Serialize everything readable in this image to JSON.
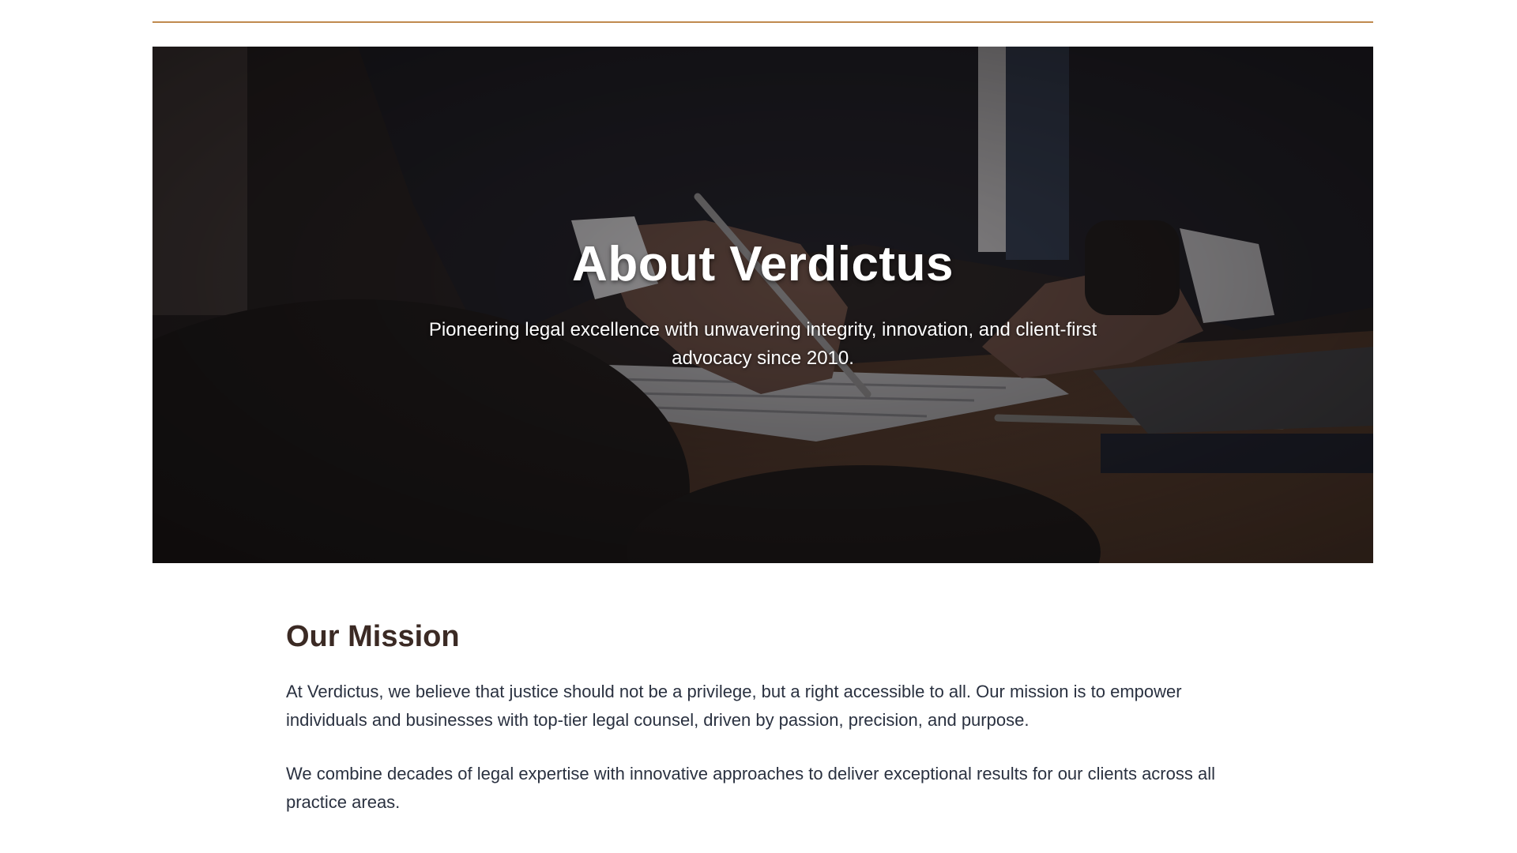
{
  "hero": {
    "title": "About Verdictus",
    "subtitle": "Pioneering legal excellence with unwavering integrity, innovation, and client-first advocacy since 2010.",
    "image": "lawyer-signing-document-photo"
  },
  "mission": {
    "heading": "Our Mission",
    "paragraphs": [
      "At Verdictus, we believe that justice should not be a privilege, but a right accessible to all. Our mission is to empower individuals and businesses with top-tier legal counsel, driven by passion, precision, and purpose.",
      "We combine decades of legal expertise with innovative approaches to deliver exceptional results for our clients across all practice areas."
    ]
  },
  "colors": {
    "accent": "#c08a4e",
    "heading": "#3b2a24",
    "body_text": "#2a3140"
  }
}
